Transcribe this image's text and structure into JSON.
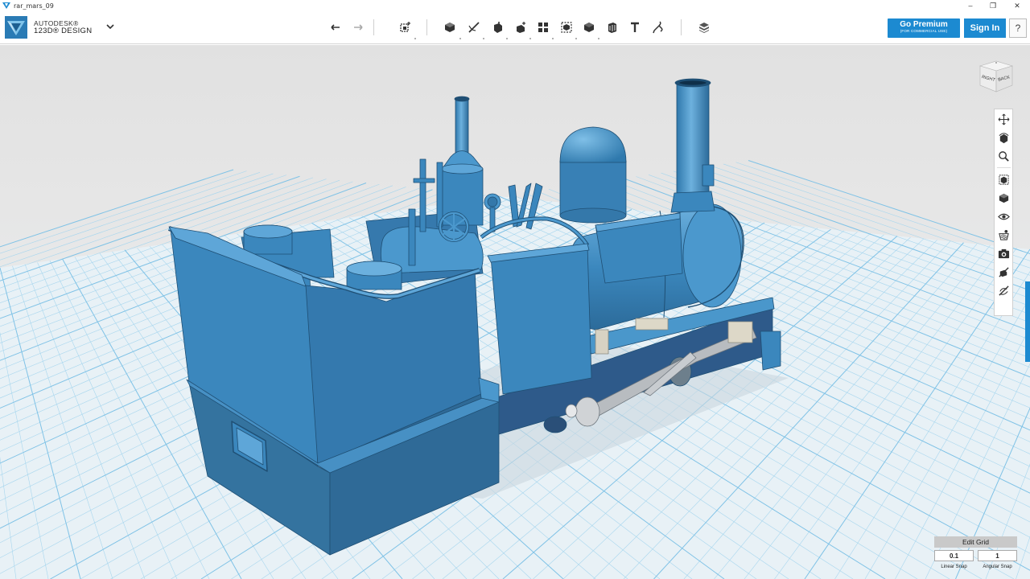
{
  "window": {
    "title": "rar_mars_09",
    "controls": {
      "minimize": "–",
      "maximize": "❐",
      "close": "✕"
    }
  },
  "brand": {
    "company": "AUTODESK®",
    "product": "123D® DESIGN",
    "menu_icon": "chevron-down-icon"
  },
  "toolbar": {
    "tools": [
      {
        "id": "undo",
        "icon": "undo-icon"
      },
      {
        "id": "redo",
        "icon": "redo-icon"
      },
      {
        "id": "transform",
        "icon": "transform-icon"
      },
      {
        "id": "primitives",
        "icon": "primitives-icon"
      },
      {
        "id": "sketch",
        "icon": "sketch-icon"
      },
      {
        "id": "construct",
        "icon": "construct-icon"
      },
      {
        "id": "modify",
        "icon": "modify-icon"
      },
      {
        "id": "pattern",
        "icon": "pattern-icon"
      },
      {
        "id": "grouping",
        "icon": "grouping-icon"
      },
      {
        "id": "combine",
        "icon": "combine-icon"
      },
      {
        "id": "measure",
        "icon": "measure-icon"
      },
      {
        "id": "text",
        "icon": "text-icon"
      },
      {
        "id": "snap",
        "icon": "snap-icon"
      },
      {
        "id": "material",
        "icon": "material-icon"
      }
    ]
  },
  "account": {
    "premium_label": "Go Premium",
    "premium_sub": "(FOR COMMERCIAL USE)",
    "signin_label": "Sign In",
    "help_label": "?"
  },
  "viewcube": {
    "left_face": "RIGHT",
    "right_face": "BACK"
  },
  "navbar": {
    "tools": [
      {
        "id": "pan",
        "icon": "pan-icon"
      },
      {
        "id": "orbit",
        "icon": "orbit-icon"
      },
      {
        "id": "zoom",
        "icon": "zoom-icon"
      },
      {
        "id": "fit",
        "icon": "fit-icon"
      },
      {
        "id": "views",
        "icon": "views-icon"
      },
      {
        "id": "visibility",
        "icon": "eye-icon"
      },
      {
        "id": "materials",
        "icon": "materials-icon"
      },
      {
        "id": "screenshot",
        "icon": "camera-icon"
      },
      {
        "id": "visibility-sketch",
        "icon": "sketch-visibility-icon"
      },
      {
        "id": "visibility-hide",
        "icon": "hide-icon"
      }
    ]
  },
  "grid": {
    "edit_label": "Edit Grid",
    "linear_snap_value": "0.1",
    "angular_snap_value": "1",
    "linear_snap_label": "Linear Snap",
    "angular_snap_label": "Angular Snap"
  },
  "colors": {
    "accent": "#1c8ad1",
    "model": "#3b87bd",
    "model_dark": "#2d6a98",
    "grid_line": "#8ec9ea",
    "viewport_top": "#e3e3e3",
    "viewport_floor": "#e9f1f5"
  }
}
